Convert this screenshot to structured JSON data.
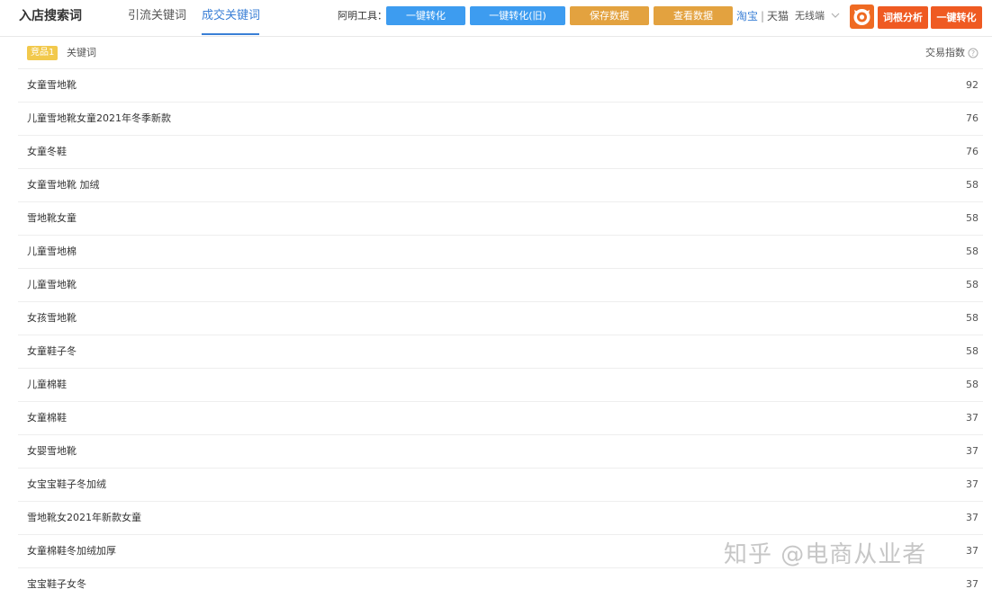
{
  "header": {
    "title": "入店搜索词",
    "tabs": [
      {
        "label": "引流关键词",
        "active": false
      },
      {
        "label": "成交关键词",
        "active": true
      }
    ]
  },
  "toolbar": {
    "label": "阿明工具：",
    "buttons": {
      "convert": "一键转化",
      "convert_old": "一键转化(旧)",
      "save": "保存数据",
      "view": "查看数据"
    },
    "platforms": {
      "taobao": "淘宝",
      "separator": "|",
      "tmall": "天猫",
      "device": "无线端"
    },
    "root_analysis": "词根分析",
    "one_click_convert": "一键转化"
  },
  "table": {
    "badge": "竞品1",
    "columns": {
      "keyword": "关键词",
      "index": "交易指数"
    },
    "rows": [
      {
        "keyword": "女童雪地靴",
        "value": "92"
      },
      {
        "keyword": "儿童雪地靴女童2021年冬季新款",
        "value": "76"
      },
      {
        "keyword": "女童冬鞋",
        "value": "76"
      },
      {
        "keyword": "女童雪地靴 加绒",
        "value": "58"
      },
      {
        "keyword": "雪地靴女童",
        "value": "58"
      },
      {
        "keyword": "儿童雪地棉",
        "value": "58"
      },
      {
        "keyword": "儿童雪地靴",
        "value": "58"
      },
      {
        "keyword": "女孩雪地靴",
        "value": "58"
      },
      {
        "keyword": "女童鞋子冬",
        "value": "58"
      },
      {
        "keyword": "儿童棉鞋",
        "value": "58"
      },
      {
        "keyword": "女童棉鞋",
        "value": "37"
      },
      {
        "keyword": "女婴雪地靴",
        "value": "37"
      },
      {
        "keyword": "女宝宝鞋子冬加绒",
        "value": "37"
      },
      {
        "keyword": "雪地靴女2021年新款女童",
        "value": "37"
      },
      {
        "keyword": "女童棉鞋冬加绒加厚",
        "value": "37"
      },
      {
        "keyword": "宝宝鞋子女冬",
        "value": "37"
      }
    ]
  },
  "watermark": "知乎 @电商从业者",
  "colors": {
    "accent_blue": "#3a7fd6",
    "button_blue": "#3d9cf0",
    "button_orange": "#e3a23f",
    "brand_red": "#ef5a22",
    "badge_yellow": "#f2c94c"
  }
}
